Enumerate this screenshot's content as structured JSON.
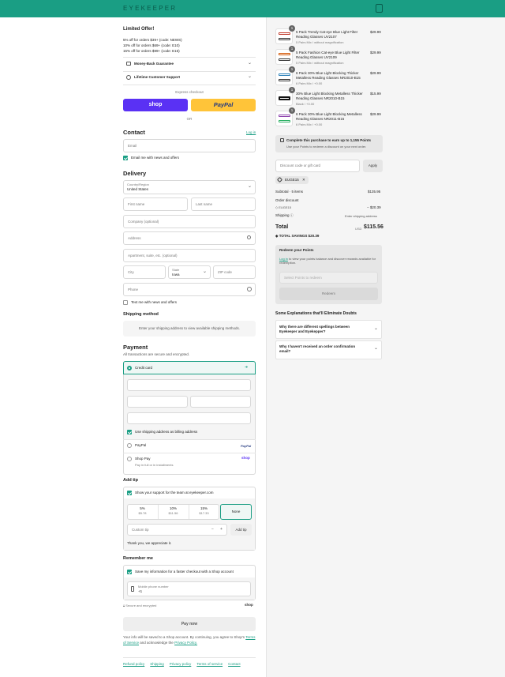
{
  "header": {
    "logo": "EYEKEEPER"
  },
  "offer": {
    "title": "Limited Offer!",
    "lines": [
      "5% off for orders $39+ (code: NEWS)",
      "10% off for orders $69+ (code: E10)",
      "15% off for orders $99+ (code: E15)"
    ]
  },
  "accordions": {
    "money_back": "Money-Back Guarantee",
    "support": "Lifetime Customer Support"
  },
  "express": {
    "label": "Express checkout",
    "shop": "shop",
    "paypal": "PayPal",
    "or": "OR"
  },
  "contact": {
    "title": "Contact",
    "login": "Log in",
    "email_placeholder": "Email",
    "news_label": "Email me with news and offers"
  },
  "delivery": {
    "title": "Delivery",
    "country_label": "Country/Region",
    "country_value": "United States",
    "first_name": "First name",
    "last_name": "Last name",
    "company": "Company (optional)",
    "address": "Address",
    "apartment": "Apartment, suite, etc. (optional)",
    "city": "City",
    "state_label": "State",
    "state_value": "Iowa",
    "zip": "ZIP code",
    "phone": "Phone",
    "text_label": "Text me with news and offers"
  },
  "shipping": {
    "title": "Shipping method",
    "message": "Enter your shipping address to view available shipping methods."
  },
  "payment": {
    "title": "Payment",
    "subtitle": "All transactions are secure and encrypted.",
    "credit_card": "Credit card",
    "billing_label": "Use shipping address as billing address",
    "paypal": "PayPal",
    "paypal_logo": "PayPal",
    "shoppay": "Shop Pay",
    "shoppay_sub": "Pay in full or in installments",
    "shoppay_logo": "shop"
  },
  "tip": {
    "title": "Add tip",
    "support_label": "Show your support for the team at eyekeeper.com",
    "options": [
      {
        "pct": "5%",
        "amt": "$5.78"
      },
      {
        "pct": "10%",
        "amt": "$11.56"
      },
      {
        "pct": "15%",
        "amt": "$17.33"
      },
      {
        "pct": "None",
        "amt": ""
      }
    ],
    "custom_placeholder": "Custom tip",
    "add_button": "Add tip",
    "thanks": "Thank you, we appreciate it."
  },
  "remember": {
    "title": "Remember me",
    "save_label": "Save my information for a faster checkout with a Shop account",
    "phone_label": "Mobile phone number",
    "phone_value": "+1",
    "secure": "Secure and encrypted",
    "shop_logo": "shop"
  },
  "pay_button": "Pay now",
  "legal": {
    "text": "Your info will be saved to a Shop account. By continuing, you agree to Shop's",
    "terms": "Terms of Service",
    "and": "and acknowledge the",
    "privacy": "Privacy Policy."
  },
  "footer_links": [
    "Refund policy",
    "Shipping",
    "Privacy policy",
    "Terms of service",
    "Contact"
  ],
  "cart": {
    "items": [
      {
        "qty": "1",
        "title": "5 Pack Trendy Cat-eye Blue Light Filter Reading Glasses UV2107",
        "variant": "5 Pairs Mix / without magnification",
        "price": "$29.99"
      },
      {
        "qty": "1",
        "title": "5 Pack Fashion Cat-eye Blue Light Filter Reading Glasses UV2109",
        "variant": "5 Pairs Mix / without magnification",
        "price": "$29.99"
      },
      {
        "qty": "1",
        "title": "6 Pack 30% Blue Light Blocking Thicker Metalless Reading Glasses NR2010-B15",
        "variant": "6 Pairs Mix / +0.00",
        "price": "$29.99"
      },
      {
        "qty": "1",
        "title": "30% Blue Light Blocking Metalless Thicker Reading Glasses NR2010-B15",
        "variant": "Black / +0.00",
        "price": "$15.99"
      },
      {
        "qty": "1",
        "title": "6 Pack 30% Blue Light Blocking Metalless Reading Glasses NR2011-B15",
        "variant": "6 Pairs Mix / +0.00",
        "price": "$29.99"
      }
    ],
    "points_title": "Complete this purchase to earn up to 1,155 Points",
    "points_sub": "Use your Points to redeem a discount on your next order.",
    "discount_placeholder": "Discount code or gift card",
    "apply": "Apply",
    "applied_code": "EUGE15",
    "subtotal_label": "Subtotal · 5 items",
    "subtotal_value": "$135.95",
    "order_discount": "Order discount",
    "discount_code": "EUGE15",
    "discount_value": "− $20.39",
    "shipping_label": "Shipping",
    "shipping_value": "Enter shipping address",
    "total_label": "Total",
    "currency": "USD",
    "total_value": "$115.56",
    "savings_label": "TOTAL SAVINGS",
    "savings_value": "$20.39"
  },
  "redeem": {
    "title": "Redeem your Points",
    "login": "Log in",
    "text": "to view your points balance and discover rewards available for redemption.",
    "select_placeholder": "Select Points to redeem",
    "button": "Redeem"
  },
  "faq": {
    "title": "Some Explanations that'll Eliminate Doubts",
    "items": [
      "Why there are different spellings between Eyekeeper and Eyekepper?",
      "Why I haven't received an order confirmation email?"
    ]
  },
  "colors": {
    "accent": "#1a9e84",
    "shop": "#5a31f4",
    "paypal": "#ffc439"
  }
}
